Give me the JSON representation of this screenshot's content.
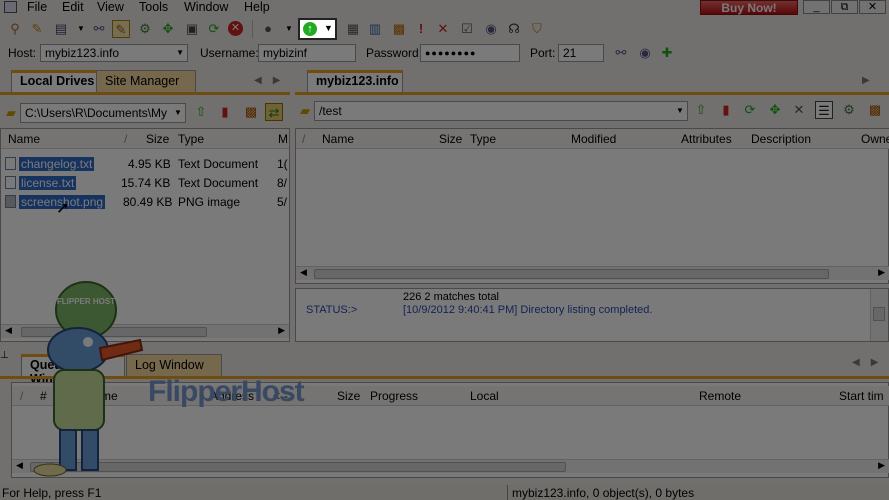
{
  "menu": [
    "File",
    "Edit",
    "View",
    "Tools",
    "Window",
    "Help"
  ],
  "buy_now": "Buy Now!",
  "window_buttons": [
    "_",
    "⧉",
    "✕"
  ],
  "connection": {
    "host_label": "Host:",
    "host_value": "mybiz123.info",
    "username_label": "Username:",
    "username_value": "mybizinf",
    "password_label": "Password:",
    "password_value": "●●●●●●●●",
    "port_label": "Port:",
    "port_value": "21"
  },
  "left_tabs": [
    "Local Drives",
    "Site Manager"
  ],
  "left_path": "C:\\Users\\R\\Documents\\My",
  "left_columns": [
    "Name",
    "/",
    "Size",
    "Type",
    "M"
  ],
  "left_files": [
    {
      "name": "changelog.txt",
      "size": "4.95 KB",
      "type": "Text Document",
      "m": "1("
    },
    {
      "name": "license.txt",
      "size": "15.74 KB",
      "type": "Text Document",
      "m": "8/"
    },
    {
      "name": "screenshot.png",
      "size": "80.49 KB",
      "type": "PNG image",
      "m": "5/"
    }
  ],
  "right_tab": "mybiz123.info",
  "right_path": "/test",
  "right_columns": [
    "/",
    "Name",
    "Size",
    "Type",
    "Modified",
    "Attributes",
    "Description",
    "Owne"
  ],
  "log": {
    "line1": "226 2 matches total",
    "status_label": "STATUS:>",
    "status_text": "[10/9/2012 9:40:41 PM] Directory listing completed."
  },
  "bottom_tabs": [
    "Queue Window",
    "Log Window"
  ],
  "queue_columns": [
    "/",
    "#",
    "Item Name",
    "Address",
    "<-->",
    "Size",
    "Progress",
    "Local",
    "Remote",
    "Start tim"
  ],
  "watermark": "FlipperHost",
  "mascot_label": "FLIPPER HOST",
  "status_bar": {
    "help": "For Help, press F1",
    "info": "mybiz123.info, 0 object(s), 0 bytes"
  },
  "icons": {
    "connect": "connect-icon",
    "upload_highlight": "up-arrow-icon"
  }
}
